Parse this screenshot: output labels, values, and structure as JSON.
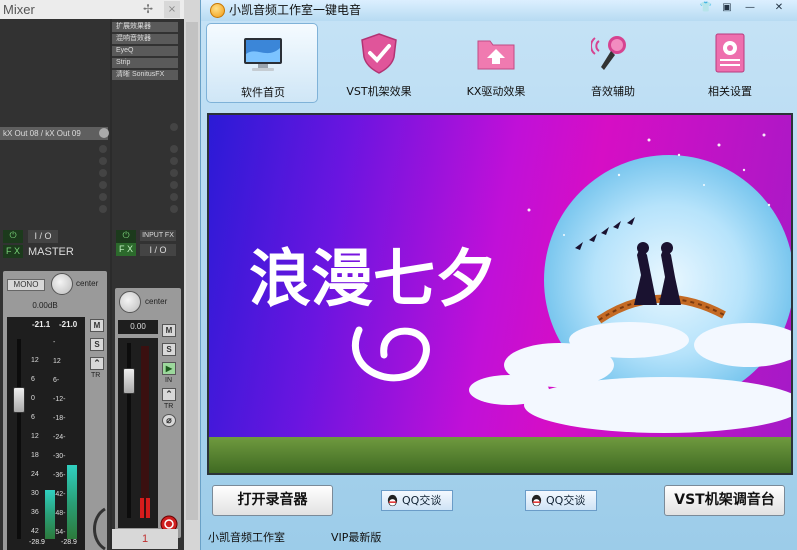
{
  "mixer": {
    "title": "Mixer",
    "close_glyph": "×",
    "pin_glyph": "✢",
    "master": {
      "routing": "kX Out 08 / kX Out 09",
      "power_glyph": "⏻",
      "fx_label": "F X",
      "io_label": "I / O",
      "name": "MASTER",
      "mono_label": "MONO",
      "pan_label": "center",
      "volume_db": "0.00dB",
      "peak_left": "-21.1",
      "peak_right": "-21.0",
      "mute_label": "M",
      "solo_label": "S",
      "trim_label": "TR",
      "meter_peak_left": "-28.9",
      "meter_peak_right": "-28.9",
      "scale_left": [
        "12",
        "6",
        "0",
        "6",
        "12",
        "18",
        "24",
        "30",
        "36",
        "42"
      ],
      "scale_mid": [
        "-",
        "12",
        "6-",
        "-12-",
        "-18-",
        "-24-",
        "-30-",
        "-36-",
        "-42-",
        "-48-",
        "-54-"
      ],
      "meter_level_left": 0.25,
      "meter_level_right": 0.38
    },
    "channel": {
      "fx_chain": [
        "扩展效果器",
        "混响音效器",
        "EyeQ",
        "Strip",
        "清晰 SonitusFX"
      ],
      "power_glyph": "⏻",
      "fx_label": "F X",
      "input_fx_label": "INPUT FX",
      "io_label": "I / O",
      "pan_label": "center",
      "volume": "0.00",
      "mute_label": "M",
      "solo_label": "S",
      "in_label": "IN",
      "trim_label": "TR",
      "number": "1"
    }
  },
  "app": {
    "title": "小凯音频工作室一键电音",
    "window_buttons": [
      "👕",
      "▣",
      "—",
      "✕"
    ],
    "nav": [
      {
        "label": "软件首页",
        "icon": "monitor-icon",
        "active": true
      },
      {
        "label": "VST机架效果",
        "icon": "shield-check-icon",
        "active": false
      },
      {
        "label": "KX驱动效果",
        "icon": "folder-upload-icon",
        "active": false
      },
      {
        "label": "音效辅助",
        "icon": "microphone-icon",
        "active": false
      },
      {
        "label": "相关设置",
        "icon": "settings-book-icon",
        "active": false
      }
    ],
    "banner_text": "浪漫七夕",
    "buttons": {
      "open_recorder": "打开录音器",
      "qq_chat_1": "QQ交谈",
      "qq_chat_2": "QQ交谈",
      "vst_console": "VST机架调音台"
    },
    "status": {
      "studio": "小凯音频工作室",
      "version": "VIP最新版"
    },
    "colors": {
      "accent": "#7fb2d8",
      "banner_left": "#2b1bd6",
      "banner_right": "#d60ec5"
    }
  }
}
